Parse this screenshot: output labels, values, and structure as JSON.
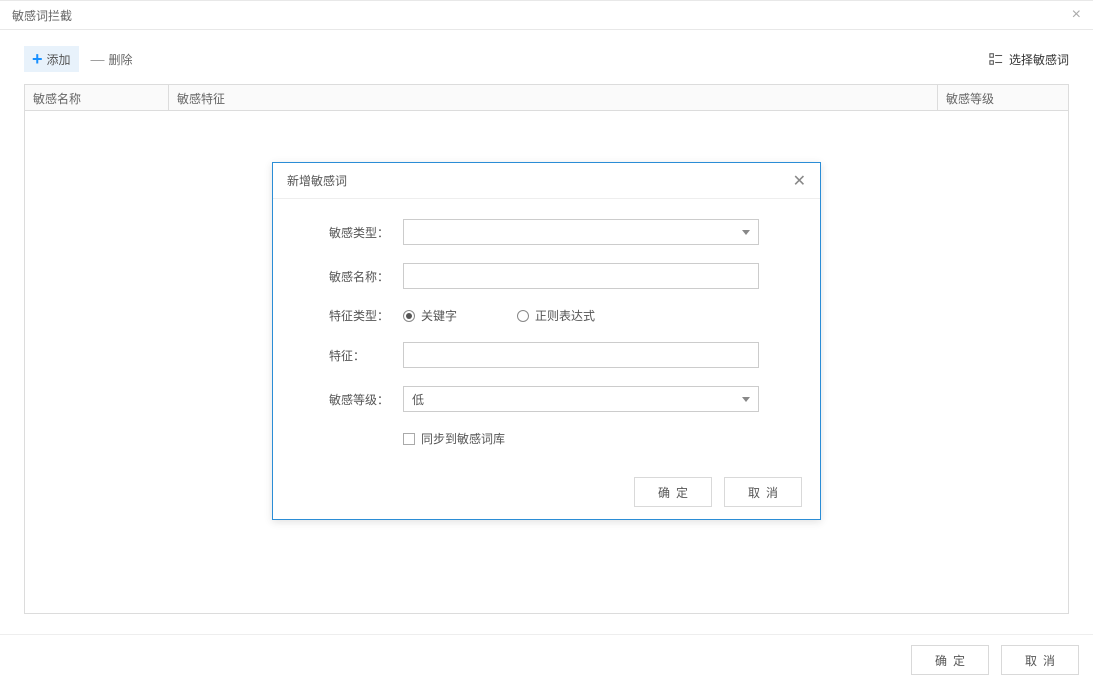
{
  "page": {
    "title": "敏感词拦截"
  },
  "toolbar": {
    "add_label": "添加",
    "delete_label": "删除",
    "select_label": "选择敏感词"
  },
  "table": {
    "columns": {
      "name": "敏感名称",
      "feature": "敏感特征",
      "level": "敏感等级"
    },
    "rows": []
  },
  "footer": {
    "ok_label": "确定",
    "cancel_label": "取消"
  },
  "modal": {
    "title": "新增敏感词",
    "fields": {
      "type_label": "敏感类型：",
      "type_value": "",
      "name_label": "敏感名称：",
      "name_value": "",
      "feature_type_label": "特征类型：",
      "feature_type_options": {
        "keyword": "关键字",
        "regex": "正则表达式"
      },
      "feature_type_selected": "keyword",
      "feature_label": "特征：",
      "feature_value": "",
      "level_label": "敏感等级：",
      "level_value": "低",
      "sync_label": "同步到敏感词库",
      "sync_checked": false
    },
    "buttons": {
      "ok": "确定",
      "cancel": "取消"
    }
  }
}
